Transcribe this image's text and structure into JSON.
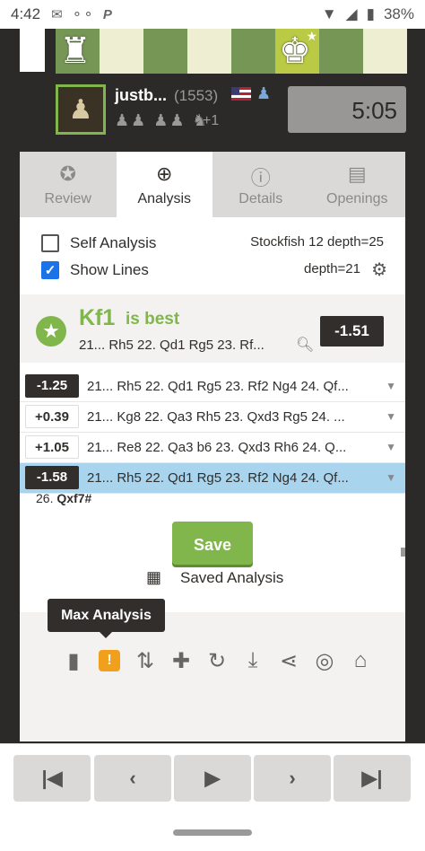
{
  "status_bar": {
    "time": "4:42",
    "battery": "38%",
    "icons": [
      "gmail-icon",
      "voicemail-icon",
      "paypal-icon",
      "wifi-icon",
      "signal-icon",
      "battery-icon"
    ]
  },
  "board": {
    "pieces": [
      "rook-icon",
      "king-icon"
    ]
  },
  "opponent": {
    "username": "justb...",
    "rating": "(1553)",
    "country": "US",
    "captured_advantage": "+1",
    "clock": "5:05"
  },
  "tabs": [
    {
      "label": "Review",
      "icon": "star-icon"
    },
    {
      "label": "Analysis",
      "icon": "magnifier-icon"
    },
    {
      "label": "Details",
      "icon": "info-icon"
    },
    {
      "label": "Openings",
      "icon": "book-icon"
    }
  ],
  "options": {
    "self_analysis": "Self Analysis",
    "show_lines": "Show Lines",
    "engine": "Stockfish 12 depth=25",
    "depth": "depth=21"
  },
  "best_move": {
    "move": "Kf1",
    "text": "is best",
    "line": "21... Rh5 22. Qd1 Rg5 23. Rf...",
    "eval": "-1.51"
  },
  "lines": [
    {
      "eval": "-1.25",
      "moves": "21... Rh5 22. Qd1 Rg5 23. Rf2 Ng4 24. Qf..."
    },
    {
      "eval": "+0.39",
      "moves": "21... Kg8 22. Qa3 Rh5 23. Qxd3 Rg5 24. ..."
    },
    {
      "eval": "+1.05",
      "moves": "21... Re8 22. Qa3 b6 23. Qxd3 Rh6 24. Q..."
    },
    {
      "eval": "-1.58",
      "moves": "21... Rh5 22. Qd1 Rg5 23. Rf2 Ng4 24. Qf..."
    }
  ],
  "overflow_move": {
    "number": "26.",
    "move": "Qxf7#"
  },
  "save": {
    "button": "Save",
    "saved_label": "Saved Analysis"
  },
  "tooltip": "Max Analysis",
  "tools": [
    "bar-chart-icon",
    "max-analysis-icon",
    "flip-board-icon",
    "add-icon",
    "refresh-icon",
    "download-icon",
    "share-icon",
    "target-icon",
    "institution-icon"
  ],
  "nav": [
    "first-move-icon",
    "previous-move-icon",
    "play-icon",
    "next-move-icon",
    "last-move-icon"
  ]
}
